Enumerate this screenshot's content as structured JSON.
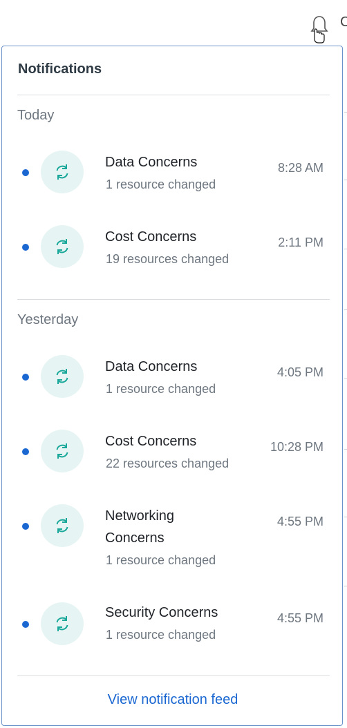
{
  "header": {
    "bell_icon": "bell-icon",
    "partial_text": "C"
  },
  "panel": {
    "title": "Notifications",
    "groups": [
      {
        "label": "Today",
        "items": [
          {
            "title": "Data Concerns",
            "subtitle": "1 resource changed",
            "time": "8:28 AM",
            "icon": "sync-icon",
            "unread": true
          },
          {
            "title": "Cost Concerns",
            "subtitle": "19 resources changed",
            "time": "2:11 PM",
            "icon": "sync-icon",
            "unread": true
          }
        ]
      },
      {
        "label": "Yesterday",
        "items": [
          {
            "title": "Data Concerns",
            "subtitle": "1 resource changed",
            "time": "4:05 PM",
            "icon": "sync-icon",
            "unread": true
          },
          {
            "title": "Cost Concerns",
            "subtitle": "22 resources changed",
            "time": "10:28 PM",
            "icon": "sync-icon",
            "unread": true
          },
          {
            "title": "Networking Concerns",
            "subtitle": "1 resource changed",
            "time": "4:55 PM",
            "icon": "sync-icon",
            "unread": true
          },
          {
            "title": "Security Concerns",
            "subtitle": "1 resource changed",
            "time": "4:55 PM",
            "icon": "sync-icon",
            "unread": true
          }
        ]
      }
    ],
    "footer_link": "View notification feed"
  },
  "colors": {
    "accent": "#1a67d2",
    "icon_bg": "#e6f5f3",
    "icon_fg": "#1aa89a",
    "panel_border": "#6b93c9"
  }
}
